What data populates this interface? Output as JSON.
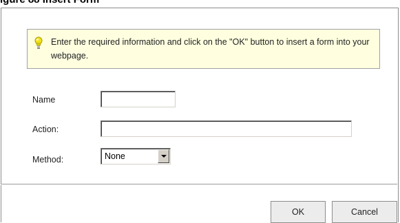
{
  "caption": "igure 88   Insert Form",
  "info": {
    "icon": "lightbulb-icon",
    "text": "Enter the required information and click on the \"OK\" button to insert a form into your webpage."
  },
  "form": {
    "name_label": "Name",
    "name_value": "",
    "action_label": "Action:",
    "action_value": "",
    "method_label": "Method:",
    "method_value": "None"
  },
  "buttons": {
    "ok": "OK",
    "cancel": "Cancel"
  }
}
